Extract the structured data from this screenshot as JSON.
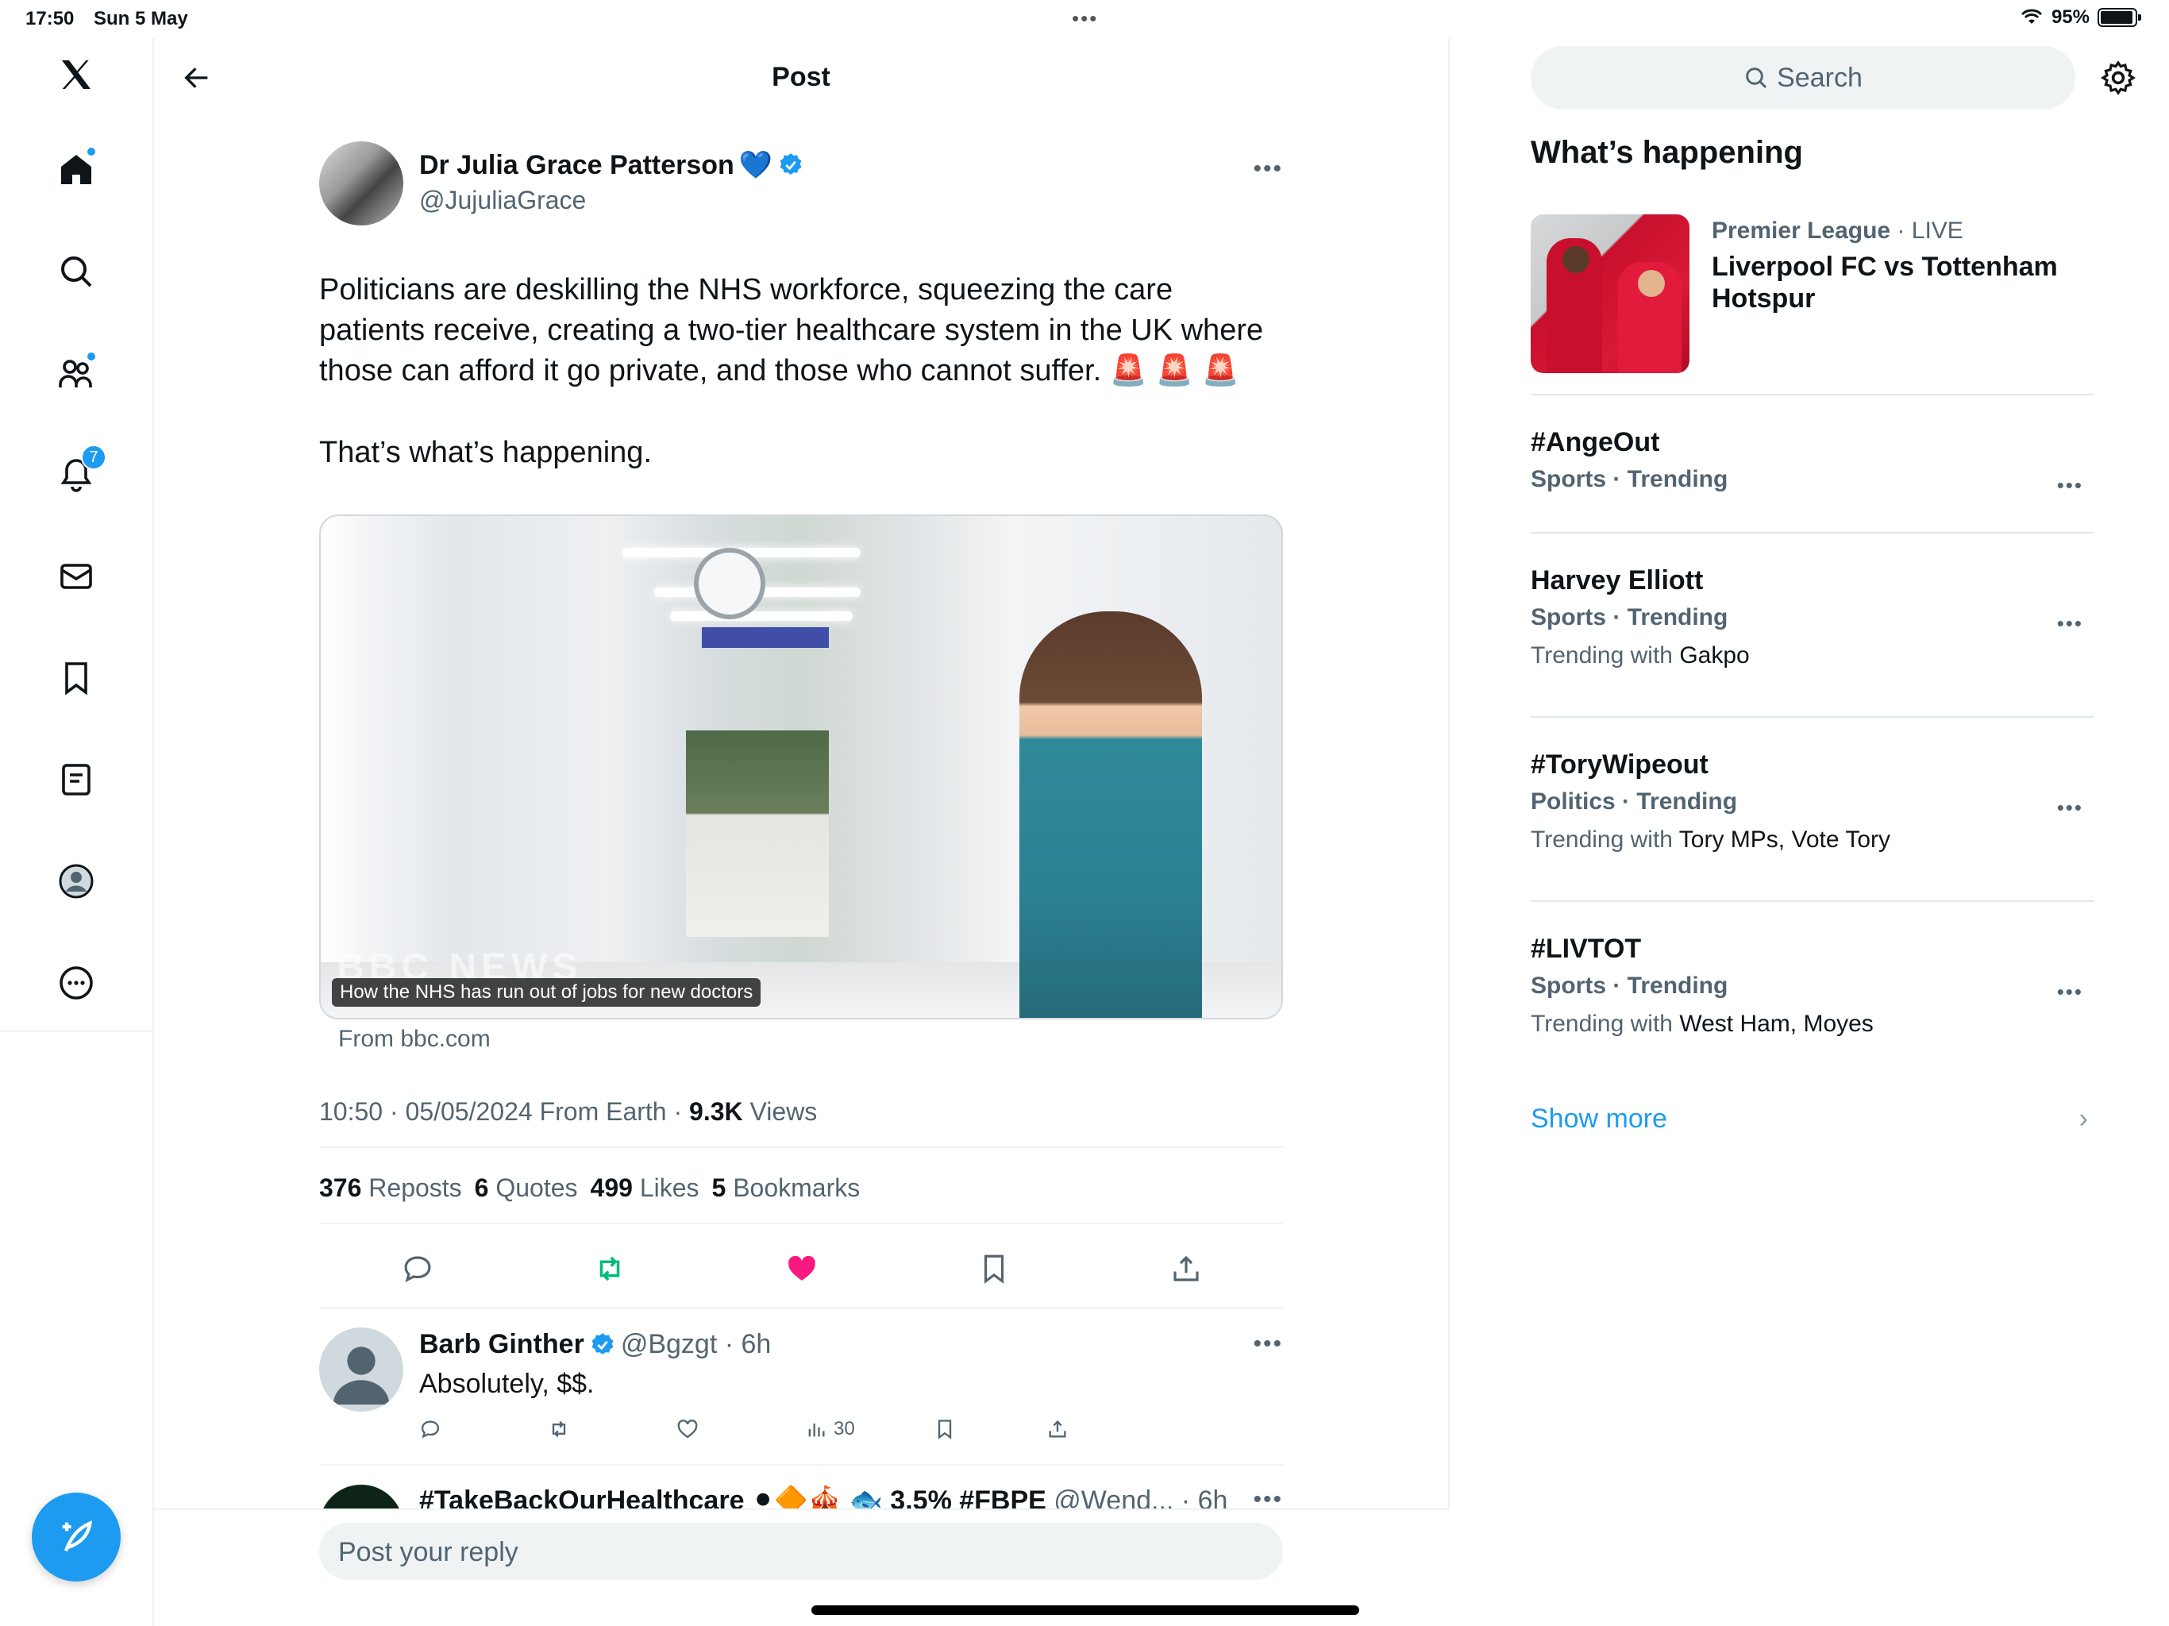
{
  "status_bar": {
    "time": "17:50",
    "date": "Sun 5 May",
    "dots": "•••",
    "battery": "95%",
    "battery_level": 0.95
  },
  "nav": {
    "notifications_count": "7"
  },
  "header": {
    "title": "Post"
  },
  "post": {
    "author_name": "Dr Julia Grace Patterson",
    "author_emoji": "💙",
    "author_handle": "@JujuliaGrace",
    "more": "•••",
    "paragraph1": "Politicians are deskilling the NHS workforce, squeezing the care patients receive, creating a two-tier healthcare system in the UK where those can afford it go private, and those who cannot suffer. 🚨 🚨 🚨",
    "paragraph2": "That’s what’s happening.",
    "card_caption": "How the NHS has run out of jobs for new doctors",
    "card_watermark": "BBC NEWS",
    "card_source": "From bbc.com",
    "timestamp": "10:50 · 05/05/2024 From Earth · ",
    "views_count": "9.3K",
    "views_label": " Views",
    "reposts_count": "376",
    "reposts_label": "Reposts",
    "quotes_count": "6",
    "quotes_label": "Quotes",
    "likes_count": "499",
    "likes_label": "Likes",
    "bookmarks_count": "5",
    "bookmarks_label": "Bookmarks"
  },
  "replies": [
    {
      "name": "Barb Ginther",
      "handle_time": "@Bgzgt · 6h",
      "text": "Absolutely, $$.",
      "views": "30"
    },
    {
      "name": "#TakeBackOurHealthcare ⚫🔶🎪 🐟 3.5% #FBPE",
      "handle_time": "@Wend... · 6h"
    }
  ],
  "composer": {
    "placeholder": "Post your reply"
  },
  "sidebar": {
    "search_placeholder": "Search",
    "title": "What’s happening",
    "live": {
      "category": "Premier League",
      "status": " · LIVE",
      "title": "Liverpool FC vs Tottenham Hotspur"
    },
    "trends": [
      {
        "name": "#AngeOut",
        "category": "Sports · Trending",
        "with_label": "",
        "with_terms": ""
      },
      {
        "name": "Harvey Elliott",
        "category": "Sports · Trending",
        "with_label": "Trending with ",
        "with_terms": "Gakpo"
      },
      {
        "name": "#ToryWipeout",
        "category": "Politics · Trending",
        "with_label": "Trending with ",
        "with_terms": "Tory MPs, Vote Tory"
      },
      {
        "name": "#LIVTOT",
        "category": "Sports · Trending",
        "with_label": "Trending with ",
        "with_terms": "West Ham, Moyes"
      }
    ],
    "show_more": "Show more"
  },
  "colors": {
    "accent": "#1d9bf0",
    "repost_active": "#00ba7c",
    "like_active": "#f91880",
    "text": "#0f1419",
    "muted": "#536471"
  }
}
